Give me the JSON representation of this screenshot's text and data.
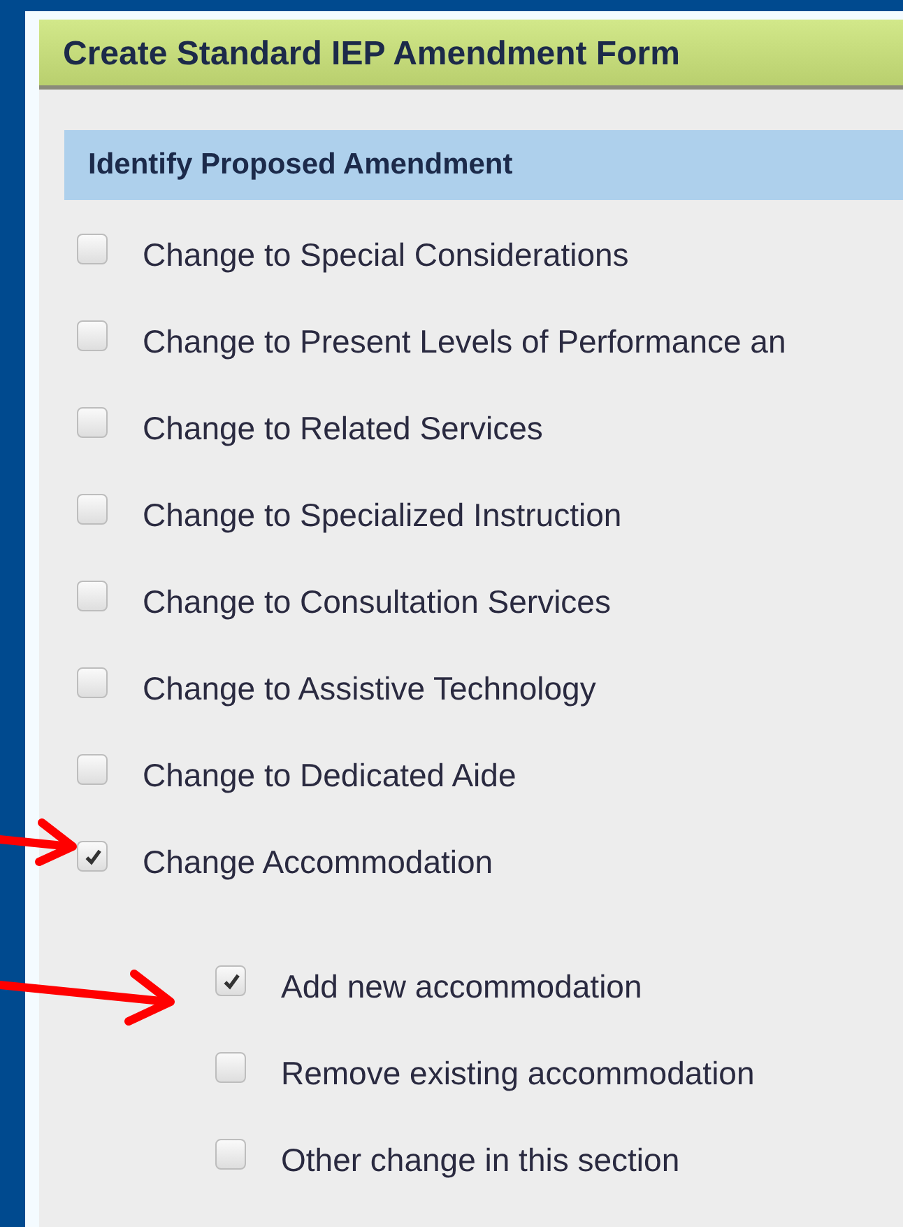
{
  "form": {
    "title": "Create Standard IEP Amendment Form"
  },
  "section": {
    "title": "Identify Proposed Amendment"
  },
  "options": [
    {
      "label": "Change to Special Considerations",
      "checked": false
    },
    {
      "label": "Change to Present Levels of Performance an",
      "checked": false
    },
    {
      "label": "Change to Related Services",
      "checked": false
    },
    {
      "label": "Change to Specialized Instruction",
      "checked": false
    },
    {
      "label": "Change to Consultation Services",
      "checked": false
    },
    {
      "label": "Change to Assistive Technology",
      "checked": false
    },
    {
      "label": "Change to Dedicated Aide",
      "checked": false
    },
    {
      "label": "Change Accommodation",
      "checked": true,
      "children": [
        {
          "label": "Add new accommodation",
          "checked": true
        },
        {
          "label": "Remove existing accommodation",
          "checked": false
        },
        {
          "label": "Other change in this section",
          "checked": false
        }
      ]
    }
  ]
}
